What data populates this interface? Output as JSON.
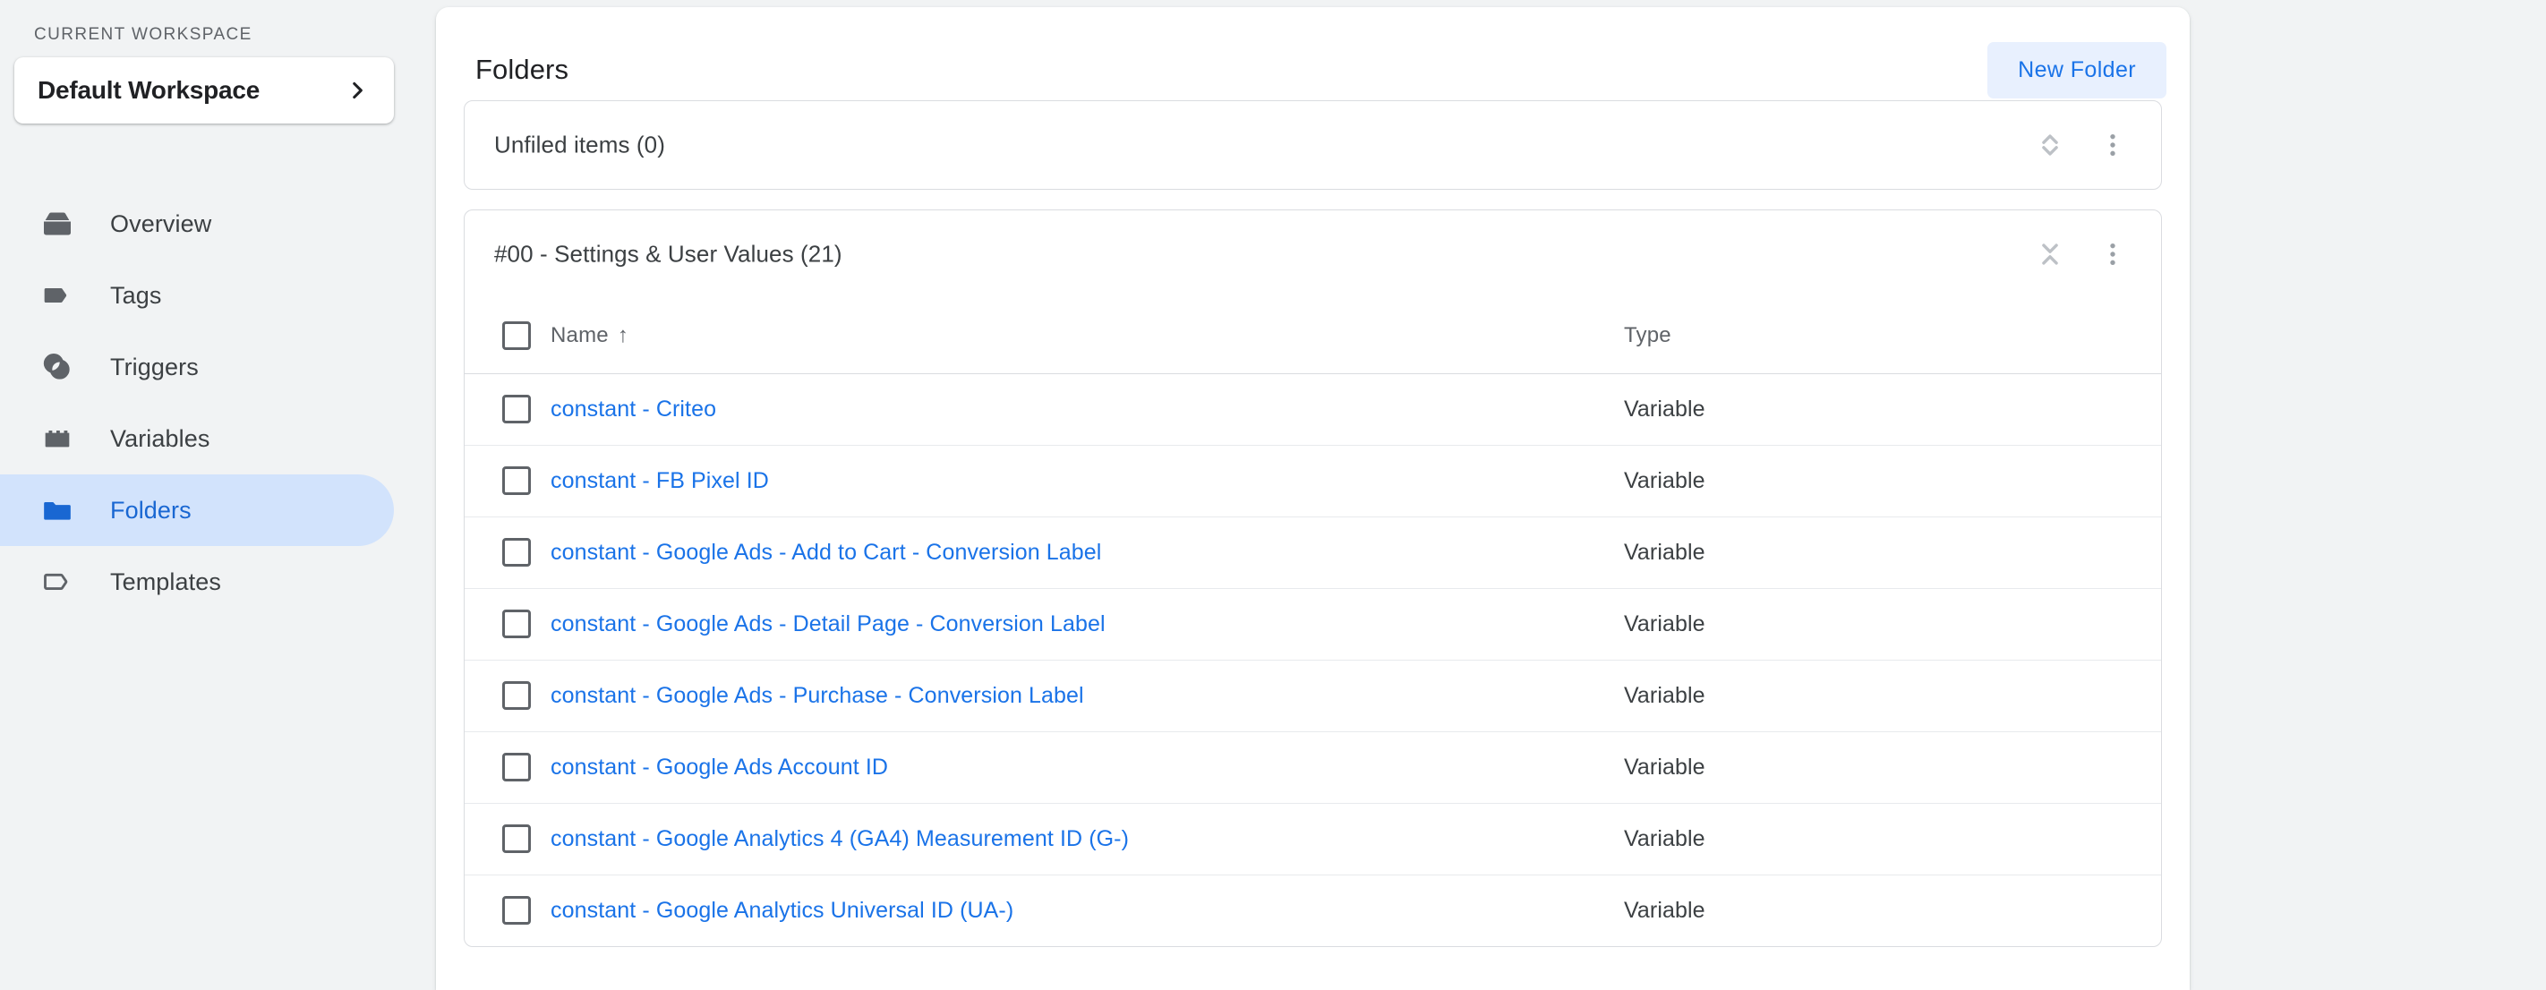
{
  "sidebar": {
    "section_label": "CURRENT WORKSPACE",
    "workspace": {
      "name": "Default Workspace",
      "chevron_icon": "chevron-right-icon"
    },
    "items": [
      {
        "label": "Overview",
        "icon": "overview-box-icon",
        "active": false
      },
      {
        "label": "Tags",
        "icon": "tag-filled-icon",
        "active": false
      },
      {
        "label": "Triggers",
        "icon": "trigger-circles-icon",
        "active": false
      },
      {
        "label": "Variables",
        "icon": "variables-block-icon",
        "active": false
      },
      {
        "label": "Folders",
        "icon": "folder-filled-icon",
        "active": true
      },
      {
        "label": "Templates",
        "icon": "tag-outline-icon",
        "active": false
      }
    ]
  },
  "main": {
    "page_title": "Folders",
    "new_folder_label": "New Folder",
    "folders": [
      {
        "title": "Unfiled items (0)",
        "expanded": false,
        "toggle_icon": "unfold-more-icon",
        "menu_icon": "more-vert-icon",
        "rows": []
      },
      {
        "title": "#00 - Settings & User Values (21)",
        "expanded": true,
        "toggle_icon": "unfold-less-icon",
        "menu_icon": "more-vert-icon",
        "columns": {
          "name": "Name",
          "name_sort": "↑",
          "type": "Type"
        },
        "rows": [
          {
            "name": "constant - Criteo",
            "type": "Variable"
          },
          {
            "name": "constant - FB Pixel ID",
            "type": "Variable"
          },
          {
            "name": "constant - Google Ads - Add to Cart - Conversion Label",
            "type": "Variable"
          },
          {
            "name": "constant - Google Ads - Detail Page - Conversion Label",
            "type": "Variable"
          },
          {
            "name": "constant - Google Ads - Purchase - Conversion Label",
            "type": "Variable"
          },
          {
            "name": "constant - Google Ads Account ID",
            "type": "Variable"
          },
          {
            "name": "constant - Google Analytics 4 (GA4) Measurement ID (G-)",
            "type": "Variable"
          },
          {
            "name": "constant - Google Analytics Universal ID (UA-)",
            "type": "Variable"
          }
        ]
      }
    ]
  },
  "colors": {
    "accent_blue": "#1a73e8",
    "active_nav_bg": "#d2e3fc",
    "active_nav_text": "#1967d2",
    "button_bg": "#e8f0fe",
    "page_bg": "#f1f3f4",
    "card_bg": "#ffffff",
    "border": "#dadce0",
    "text_primary": "#202124",
    "text_secondary": "#5f6368",
    "icon_gray": "#5f6368"
  }
}
